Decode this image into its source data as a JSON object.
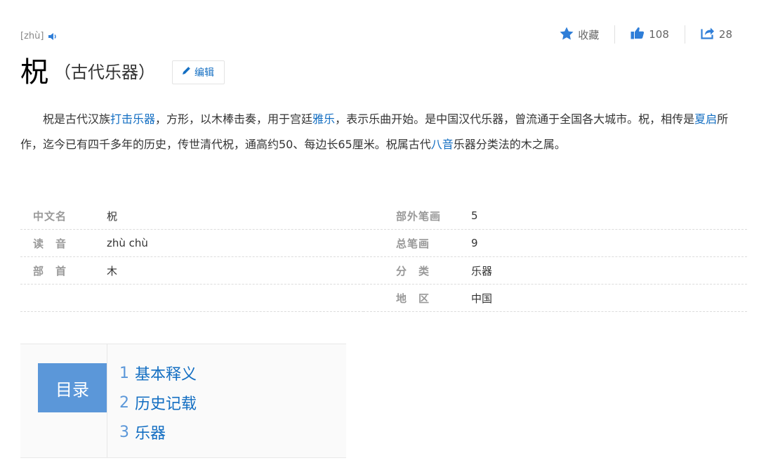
{
  "entry": {
    "pinyin": "[zhù]",
    "character": "柷",
    "subtitle": "（古代乐器）",
    "edit_label": "编辑"
  },
  "actions": {
    "collect_label": "收藏",
    "like_count": "108",
    "share_count": "28"
  },
  "intro": {
    "segments": [
      {
        "text": "柷是古代汉族",
        "link": false
      },
      {
        "text": "打击乐器",
        "link": true
      },
      {
        "text": "，方形，以木棒击奏，用于宫廷",
        "link": false
      },
      {
        "text": "雅乐",
        "link": true
      },
      {
        "text": "，表示乐曲开始。是中国汉代乐器，曾流通于全国各大城市。柷，相传是",
        "link": false
      },
      {
        "text": "夏启",
        "link": true
      },
      {
        "text": "所作，迄今已有四千多年的历史，传世清代柷，通高约50、每边长65厘米。柷属古代",
        "link": false
      },
      {
        "text": "八音",
        "link": true
      },
      {
        "text": "乐器分类法的木之属。",
        "link": false
      }
    ]
  },
  "basic_info": {
    "left": [
      {
        "key": "中文名",
        "value": "柷"
      },
      {
        "key": "读　音",
        "value": "zhù chù"
      },
      {
        "key": "部　首",
        "value": "木"
      }
    ],
    "right": [
      {
        "key": "部外笔画",
        "value": "5"
      },
      {
        "key": "总笔画",
        "value": "9"
      },
      {
        "key": "分　类",
        "value": "乐器"
      },
      {
        "key": "地　区",
        "value": "中国"
      }
    ]
  },
  "catalog": {
    "label": "目录",
    "items": [
      {
        "num": "1",
        "text": "基本释义"
      },
      {
        "num": "2",
        "text": "历史记载"
      },
      {
        "num": "3",
        "text": "乐器"
      }
    ]
  },
  "colors": {
    "link": "#136ec2",
    "catalog_bg": "#5b97d9"
  }
}
